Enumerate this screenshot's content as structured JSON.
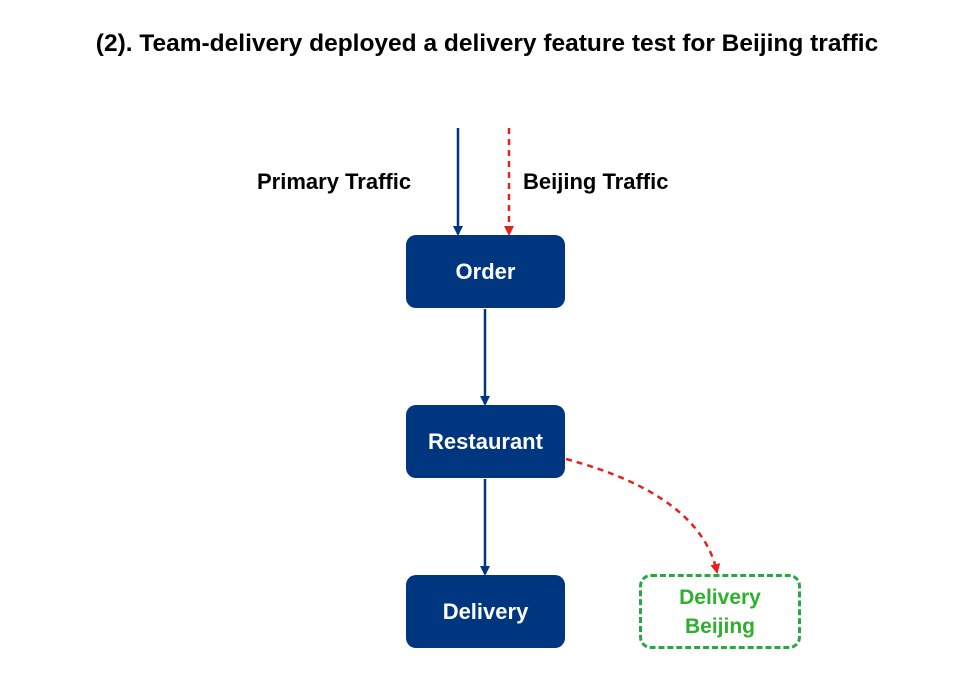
{
  "title": "(2). Team-delivery deployed a delivery feature test for Beijing traffic",
  "labels": {
    "primary_traffic": "Primary Traffic",
    "beijing_traffic": "Beijing Traffic"
  },
  "nodes": {
    "order": "Order",
    "restaurant": "Restaurant",
    "delivery": "Delivery",
    "delivery_beijing_line1": "Delivery",
    "delivery_beijing_line2": "Beijing"
  },
  "colors": {
    "node_fill": "#003580",
    "primary_arrow": "#003580",
    "beijing_arrow": "#e8201b",
    "beijing_node": "#2db02d"
  }
}
